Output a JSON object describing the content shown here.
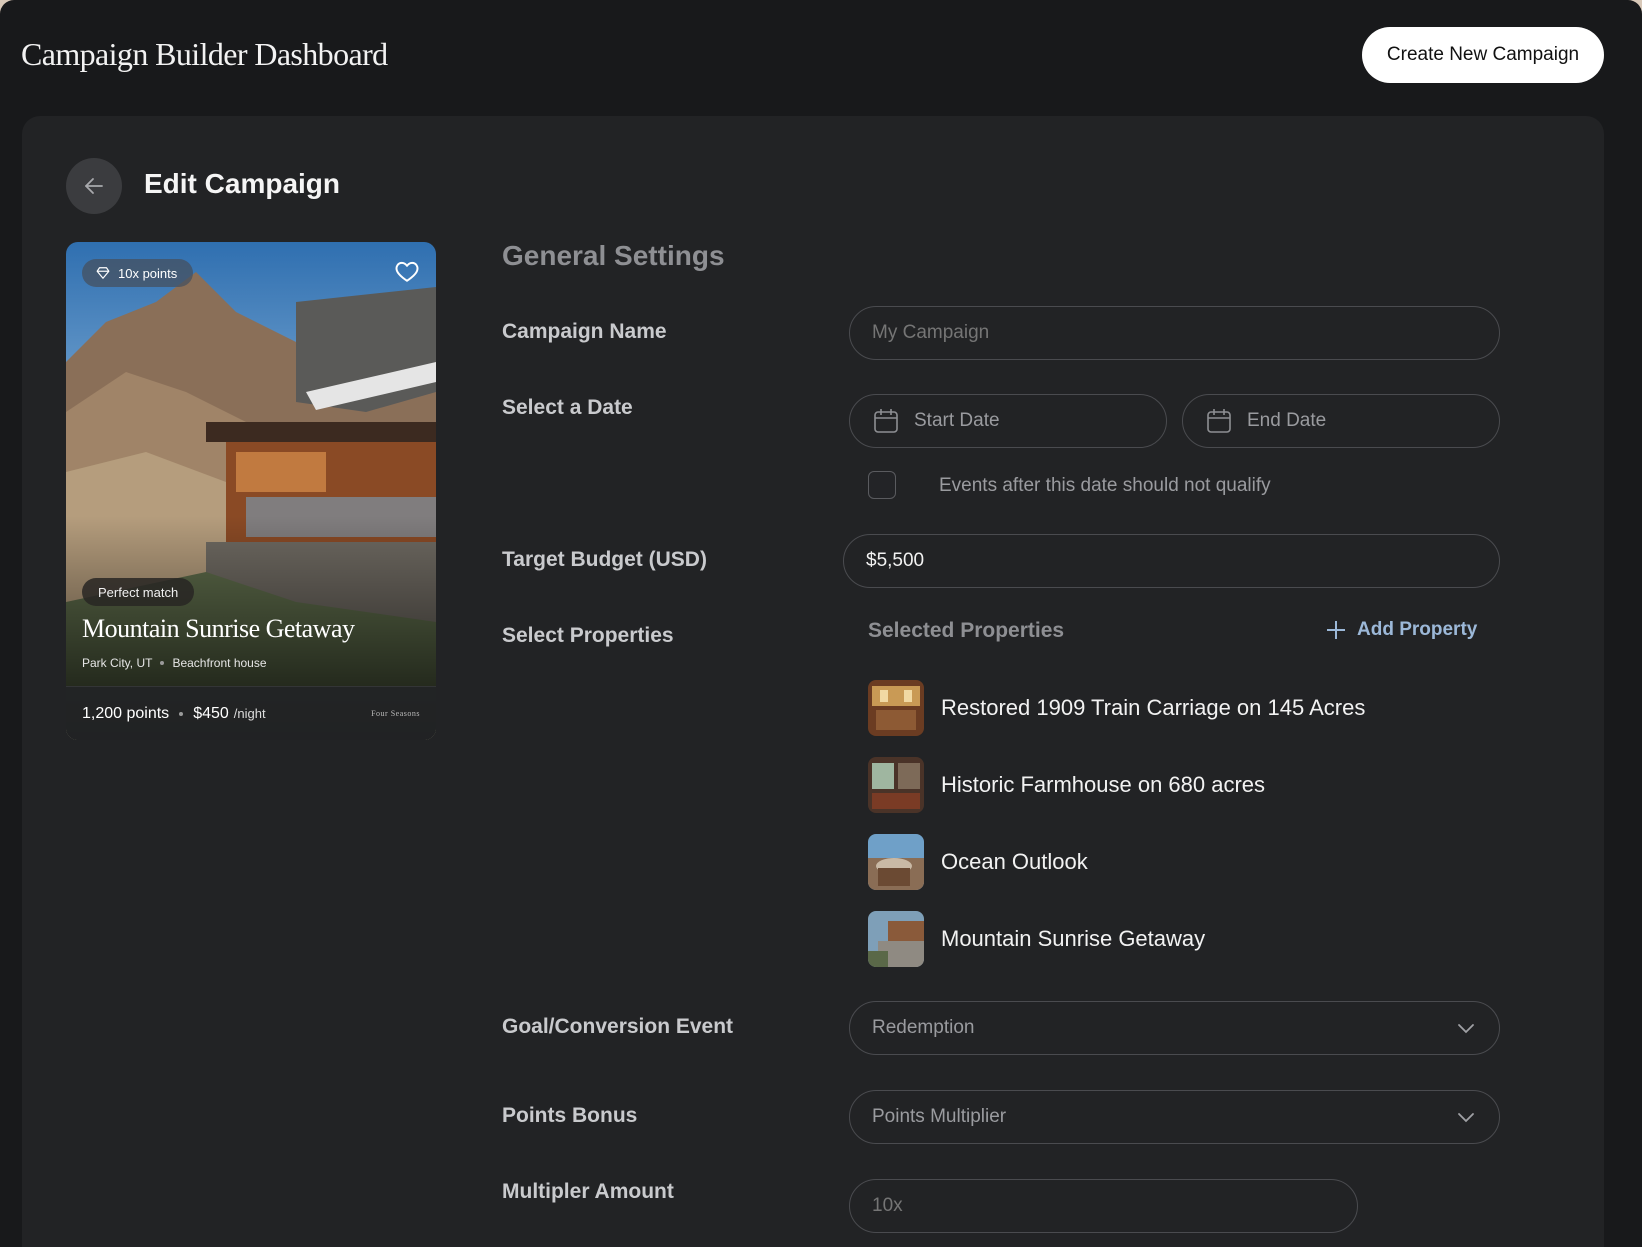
{
  "header": {
    "app_title": "Campaign Builder Dashboard",
    "create_button": "Create New Campaign"
  },
  "page": {
    "title": "Edit Campaign"
  },
  "card": {
    "points_badge": "10x points",
    "match_badge": "Perfect match",
    "name": "Mountain Sunrise Getaway",
    "location": "Park City, UT",
    "type": "Beachfront house",
    "points": "1,200 points",
    "price": "$450",
    "price_unit": "/night",
    "brand": "Four Seasons"
  },
  "form": {
    "section_title": "General Settings",
    "campaign_name_label": "Campaign Name",
    "campaign_name_placeholder": "My Campaign",
    "date_label": "Select a Date",
    "start_date_placeholder": "Start Date",
    "end_date_placeholder": "End Date",
    "qualify_checkbox_label": "Events after this date should not qualify",
    "qualify_checked": false,
    "budget_label": "Target Budget (USD)",
    "budget_value": "$5,500",
    "properties_label": "Select Properties",
    "selected_properties_title": "Selected Properties",
    "add_property": "Add  Property",
    "properties": [
      {
        "name": "Restored 1909 Train Carriage on 145 Acres"
      },
      {
        "name": "Historic Farmhouse on 680 acres"
      },
      {
        "name": "Ocean Outlook"
      },
      {
        "name": "Mountain Sunrise Getaway"
      }
    ],
    "goal_label": "Goal/Conversion Event",
    "goal_value": "Redemption",
    "bonus_label": "Points Bonus",
    "bonus_value": "Points Multiplier",
    "multiplier_label": "Multipler Amount",
    "multiplier_placeholder": "10x"
  },
  "colors": {
    "background": "#18191b",
    "panel": "#222325",
    "accent_link": "#9cb8d8"
  }
}
